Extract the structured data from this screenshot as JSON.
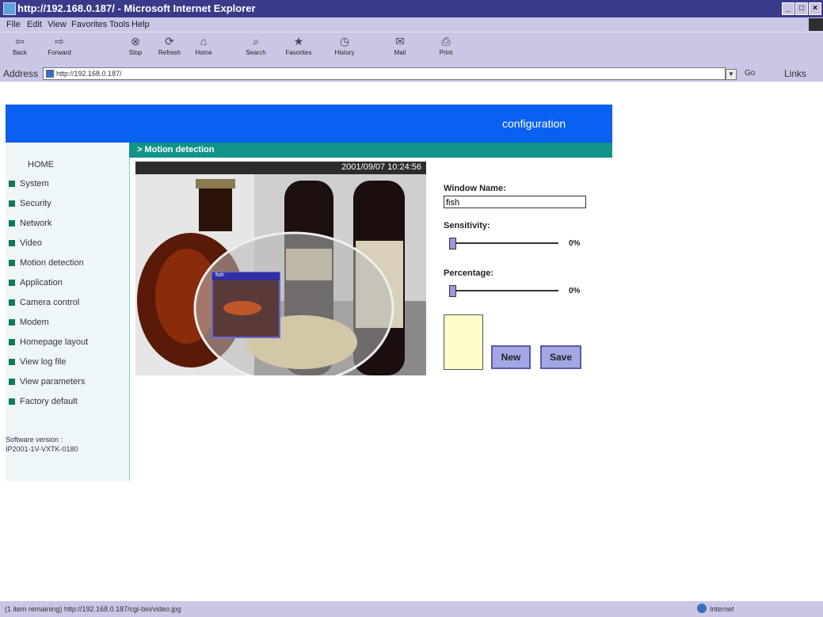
{
  "window": {
    "title": "http://192.168.0.187/ - Microsoft Internet Explorer"
  },
  "menu": [
    "File",
    "Edit",
    "View",
    "Favorites",
    "Tools",
    "Help"
  ],
  "toolbar": {
    "buttons": [
      "Back",
      "Forward",
      "Stop",
      "Refresh",
      "Home",
      "Search",
      "Favorites",
      "History",
      "Mail",
      "Print"
    ]
  },
  "address": {
    "label": "Address",
    "url": "http://192.168.0.187/",
    "go": "Go",
    "links": "Links"
  },
  "banner": {
    "label": "configuration"
  },
  "section": {
    "title": "> Motion detection"
  },
  "sidebar": {
    "home": "HOME",
    "items": [
      "System",
      "Security",
      "Network",
      "Video",
      "Motion detection",
      "Application",
      "Camera control",
      "Modem",
      "Homepage layout",
      "View log file",
      "View parameters",
      "Factory default"
    ],
    "software_label": "Software version :",
    "software_value": "IP2001-1V-VXTK-0180"
  },
  "camera": {
    "timestamp": "2001/09/07 10:24:56",
    "window_label": "fish"
  },
  "form": {
    "window_name_label": "Window Name:",
    "window_name_value": "fish",
    "sensitivity_label": "Sensitivity:",
    "sensitivity_value": "0%",
    "sensitivity_level": 0,
    "percentage_label": "Percentage:",
    "percentage_value": "0%",
    "percentage_level": 0,
    "new_button": "New",
    "save_button": "Save"
  },
  "status": {
    "message": "(1 item remaining) http://192.168.0.187/cgi-bin/video.jpg",
    "zone": "Internet"
  },
  "colors": {
    "banner": "#0a60f0",
    "section_bar": "#109488",
    "chrome": "#c9c6e6",
    "titlebar": "#3a3a8a"
  }
}
